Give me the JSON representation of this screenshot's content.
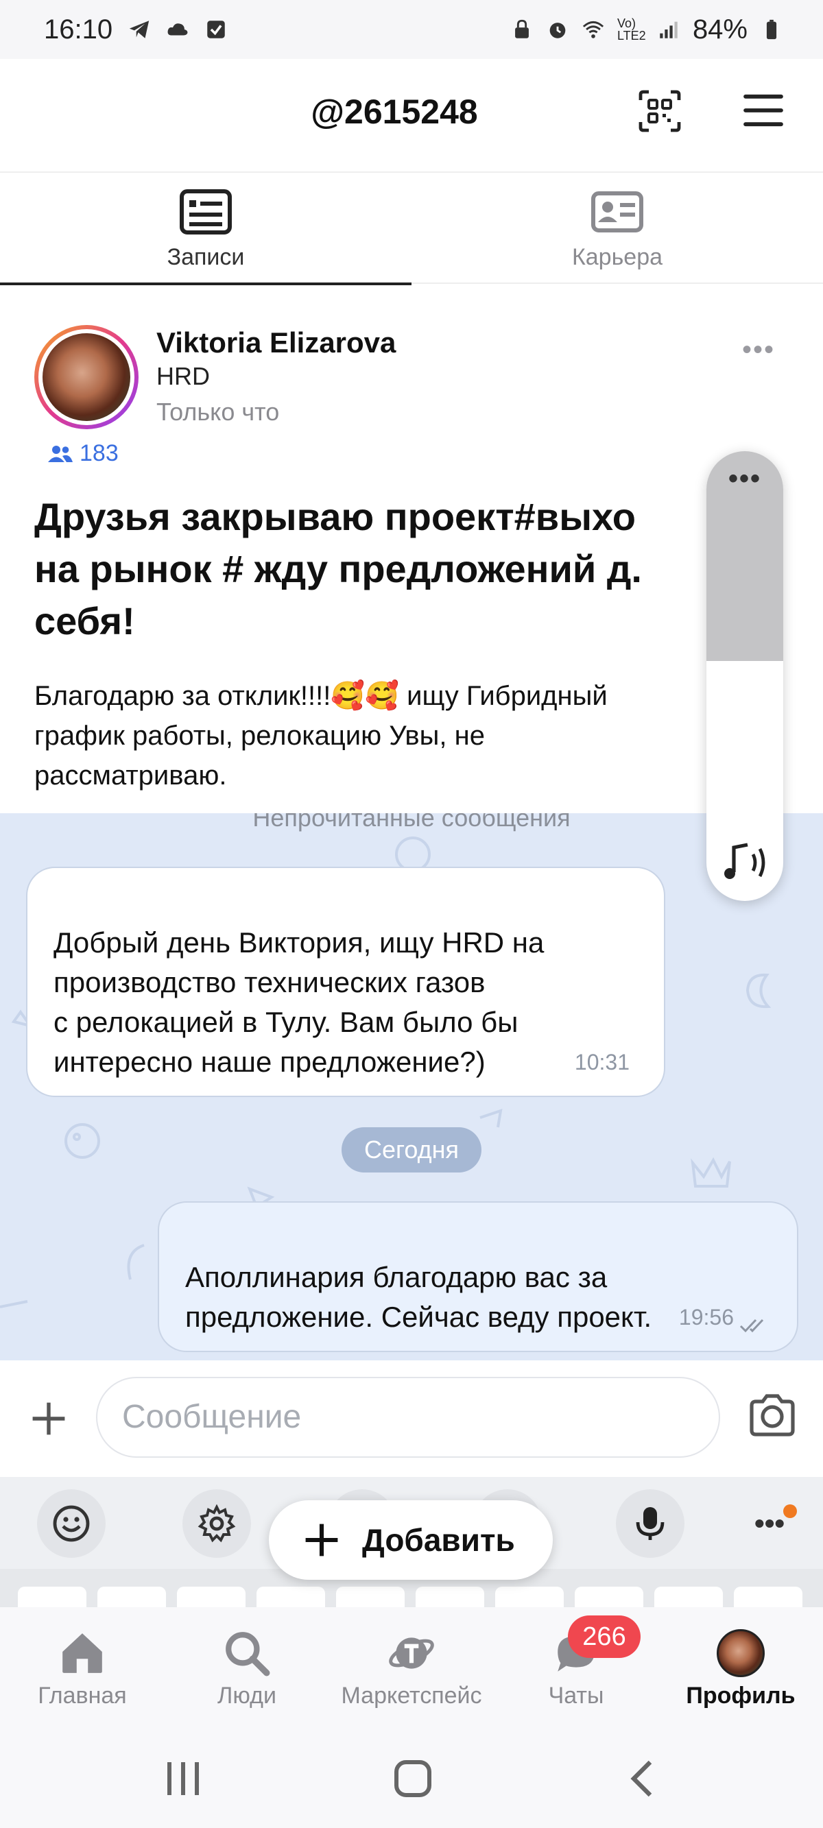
{
  "status_bar": {
    "time": "16:10",
    "battery": "84%",
    "network": "Vo) LTE2"
  },
  "header": {
    "username": "@2615248"
  },
  "tabs": [
    {
      "label": "Записи",
      "active": true,
      "icon": "posts-icon"
    },
    {
      "label": "Карьера",
      "active": false,
      "icon": "id-card-icon"
    }
  ],
  "post": {
    "author": "Viktoria Elizarova",
    "role": "HRD",
    "time": "Только что",
    "followers": "183",
    "title": "Друзья закрываю проект#выхо\nна рынок # жду предложений д.\nсебя!",
    "body": "Благодарю за отклик!!!!🥰🥰 ищу Гибридный\nграфик работы, релокацию Увы, не\nрассматриваю."
  },
  "chat": {
    "unread_banner": "Непрочитанные сообщения",
    "messages": [
      {
        "direction": "in",
        "text": "Добрый день Виктория, ищу HRD на\nпроизводство технических газов\nс релокацией в Тулу. Вам было бы\nинтересно наше предложение?)",
        "time": "10:31"
      },
      {
        "direction": "out",
        "text": "Аполлинария благодарю вас за\nпредложение. Сейчас веду проект.",
        "time": "19:56",
        "read": true
      }
    ],
    "date_separator": "Сегодня"
  },
  "input": {
    "placeholder": "Сообщение"
  },
  "fab": {
    "label": "Добавить"
  },
  "bottom_nav": [
    {
      "label": "Главная",
      "icon": "home-icon",
      "active": false
    },
    {
      "label": "Люди",
      "icon": "search-icon",
      "active": false
    },
    {
      "label": "Маркетспейс",
      "icon": "planet-icon",
      "active": false
    },
    {
      "label": "Чаты",
      "icon": "chat-icon",
      "active": false,
      "badge": "266"
    },
    {
      "label": "Профиль",
      "icon": "avatar",
      "active": true
    }
  ],
  "colors": {
    "accent": "#3a6fe0",
    "badge": "#f0474f",
    "chat_bg": "#dfe8f7",
    "date_pill": "#a6b8d4"
  }
}
